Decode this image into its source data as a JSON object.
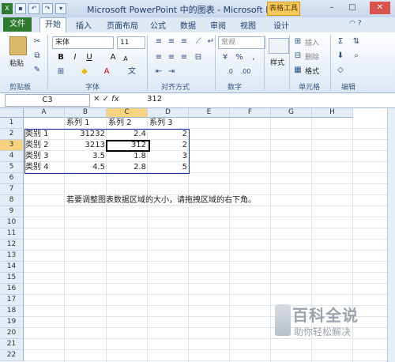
{
  "window": {
    "title": "Microsoft PowerPoint 中的图表 - Microsoft Excel(...",
    "context_tab": "表格工具"
  },
  "tabs": [
    "文件",
    "开始",
    "插入",
    "页面布局",
    "公式",
    "数据",
    "审阅",
    "视图",
    "设计"
  ],
  "ribbon": {
    "paste_label": "粘贴",
    "font_name": "宋体",
    "font_size": "11",
    "number_format": "常规",
    "style_label": "样式",
    "insert_label": "插入",
    "delete_label": "删除",
    "format_label": "格式",
    "groups": {
      "clipboard": "剪贴板",
      "font": "字体",
      "alignment": "对齐方式",
      "number": "数字",
      "cells": "单元格",
      "editing": "编辑"
    }
  },
  "formula_bar": {
    "name_box": "C3",
    "formula": "312"
  },
  "sheet": {
    "columns": [
      "A",
      "B",
      "C",
      "D",
      "E",
      "F",
      "G",
      "H"
    ],
    "rows": [
      "1",
      "2",
      "3",
      "4",
      "5",
      "6",
      "7",
      "8",
      "9",
      "10",
      "11",
      "12",
      "13",
      "14",
      "15",
      "16",
      "17",
      "18",
      "19",
      "20",
      "21",
      "22"
    ],
    "selected_cell": "C3",
    "cells": {
      "B1": "系列 1",
      "C1": "系列 2",
      "D1": "系列 3",
      "A2": "类别 1",
      "B2": "31232",
      "C2": "2.4",
      "D2": "2",
      "A3": "类别 2",
      "B3": "3213",
      "C3": "312",
      "D3": "2",
      "A4": "类别 3",
      "B4": "3.5",
      "C4": "1.8",
      "D4": "3",
      "A5": "类别 4",
      "B5": "4.5",
      "C5": "2.8",
      "D5": "5",
      "B8": "若要调整图表数据区域的大小，请拖拽区域的右下角。"
    }
  },
  "watermark": {
    "main": "百科全说",
    "sub": "助你轻松解决"
  },
  "colors": {
    "file_tab": "#2e7a2e",
    "selection_border": "#000000",
    "table_border": "#1f3d99",
    "context_tab": "#f2c95a"
  }
}
